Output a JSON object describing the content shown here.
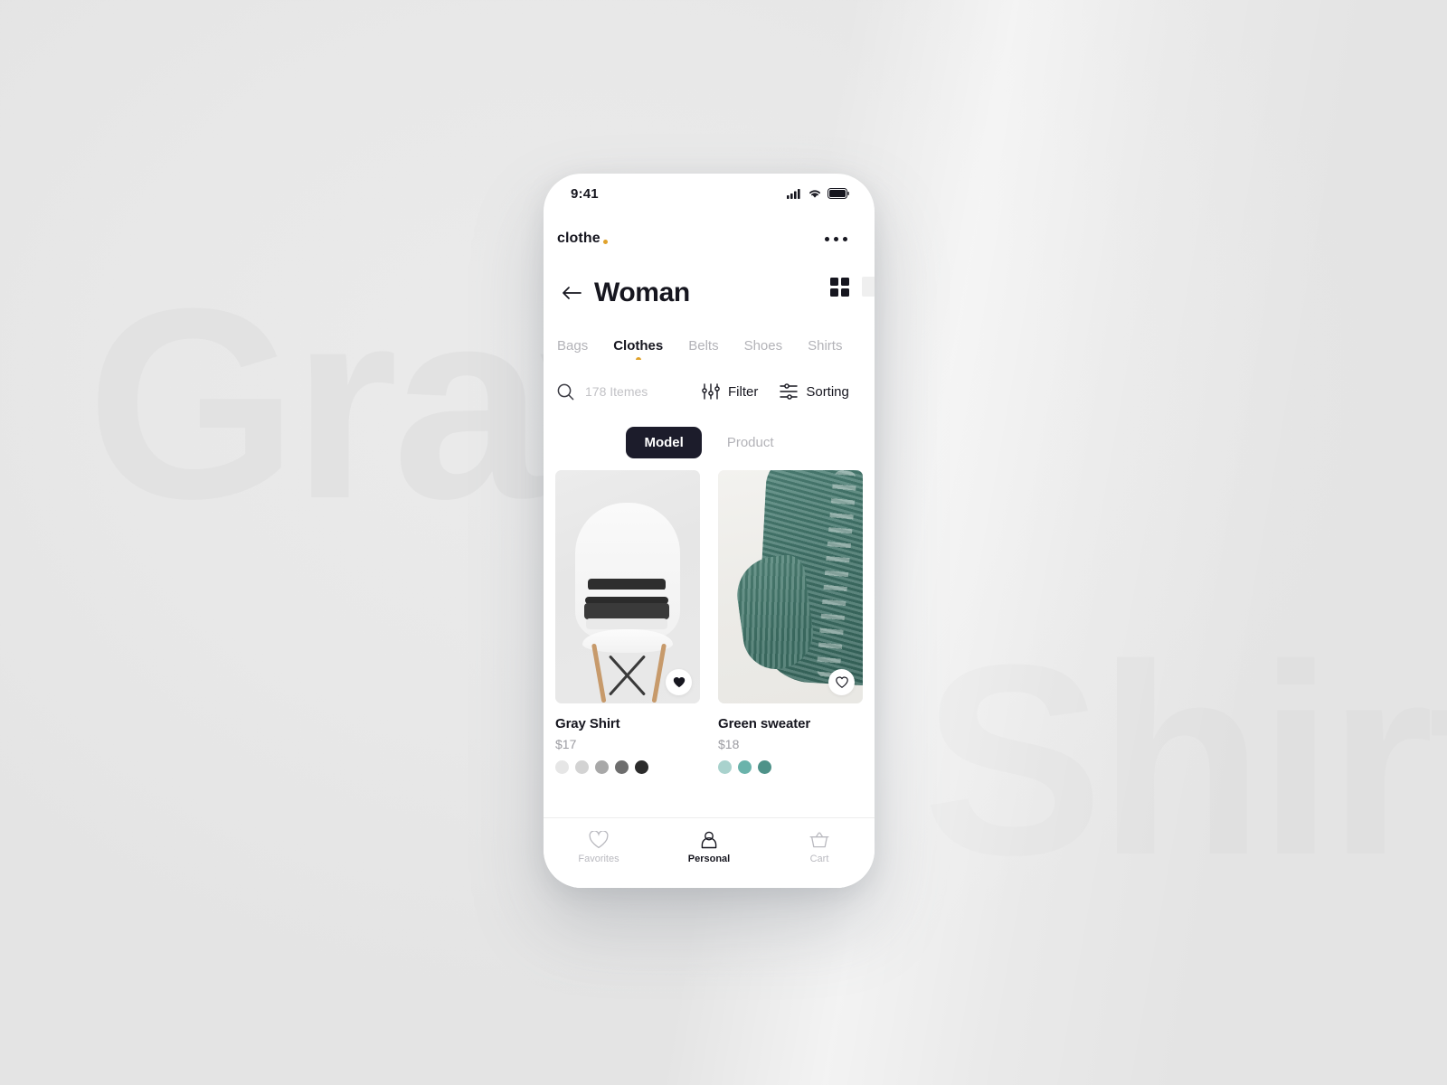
{
  "background": {
    "watermark_left": "Gray",
    "watermark_right": "Shirt",
    "color": "#e8e8e8"
  },
  "statusbar": {
    "time": "9:41",
    "icons": [
      "signal-icon",
      "wifi-icon",
      "battery-icon"
    ]
  },
  "brand": {
    "name": "clothe",
    "dot_color": "#e0a22b",
    "menu_icon": "more-horizontal-icon"
  },
  "header": {
    "back_icon": "arrow-left-icon",
    "title": "Woman",
    "view_grid_icon": "grid-view-icon",
    "view_list_icon": "square-view-icon"
  },
  "categories": {
    "items": [
      {
        "label": "Bags",
        "active": false
      },
      {
        "label": "Clothes",
        "active": true
      },
      {
        "label": "Belts",
        "active": false
      },
      {
        "label": "Shoes",
        "active": false
      },
      {
        "label": "Shirts",
        "active": false
      }
    ],
    "active_dot_color": "#e0a22b"
  },
  "tools": {
    "search_icon": "search-icon",
    "search_placeholder": "178 Itemes",
    "filter_icon": "filter-sliders-icon",
    "filter_label": "Filter",
    "sorting_icon": "sorting-sliders-icon",
    "sorting_label": "Sorting"
  },
  "segmented": {
    "options": [
      {
        "label": "Model",
        "selected": true
      },
      {
        "label": "Product",
        "selected": false
      }
    ],
    "active_bg": "#1c1c2b"
  },
  "products": [
    {
      "name": "Gray Shirt",
      "price": "$17",
      "favorited": true,
      "favorite_icon": "heart-filled-icon",
      "swatches": [
        "#e6e6e6",
        "#d3d3d3",
        "#a8a8a8",
        "#6d6d6d",
        "#2b2b2b"
      ]
    },
    {
      "name": "Green sweater",
      "price": "$18",
      "favorited": false,
      "favorite_icon": "heart-outline-icon",
      "swatches": [
        "#a9d2cd",
        "#6ab3ab",
        "#4e9289"
      ]
    }
  ],
  "tabbar": {
    "items": [
      {
        "label": "Favorites",
        "icon": "heart-icon",
        "active": false
      },
      {
        "label": "Personal",
        "icon": "person-icon",
        "active": true
      },
      {
        "label": "Cart",
        "icon": "basket-icon",
        "active": false
      }
    ]
  }
}
